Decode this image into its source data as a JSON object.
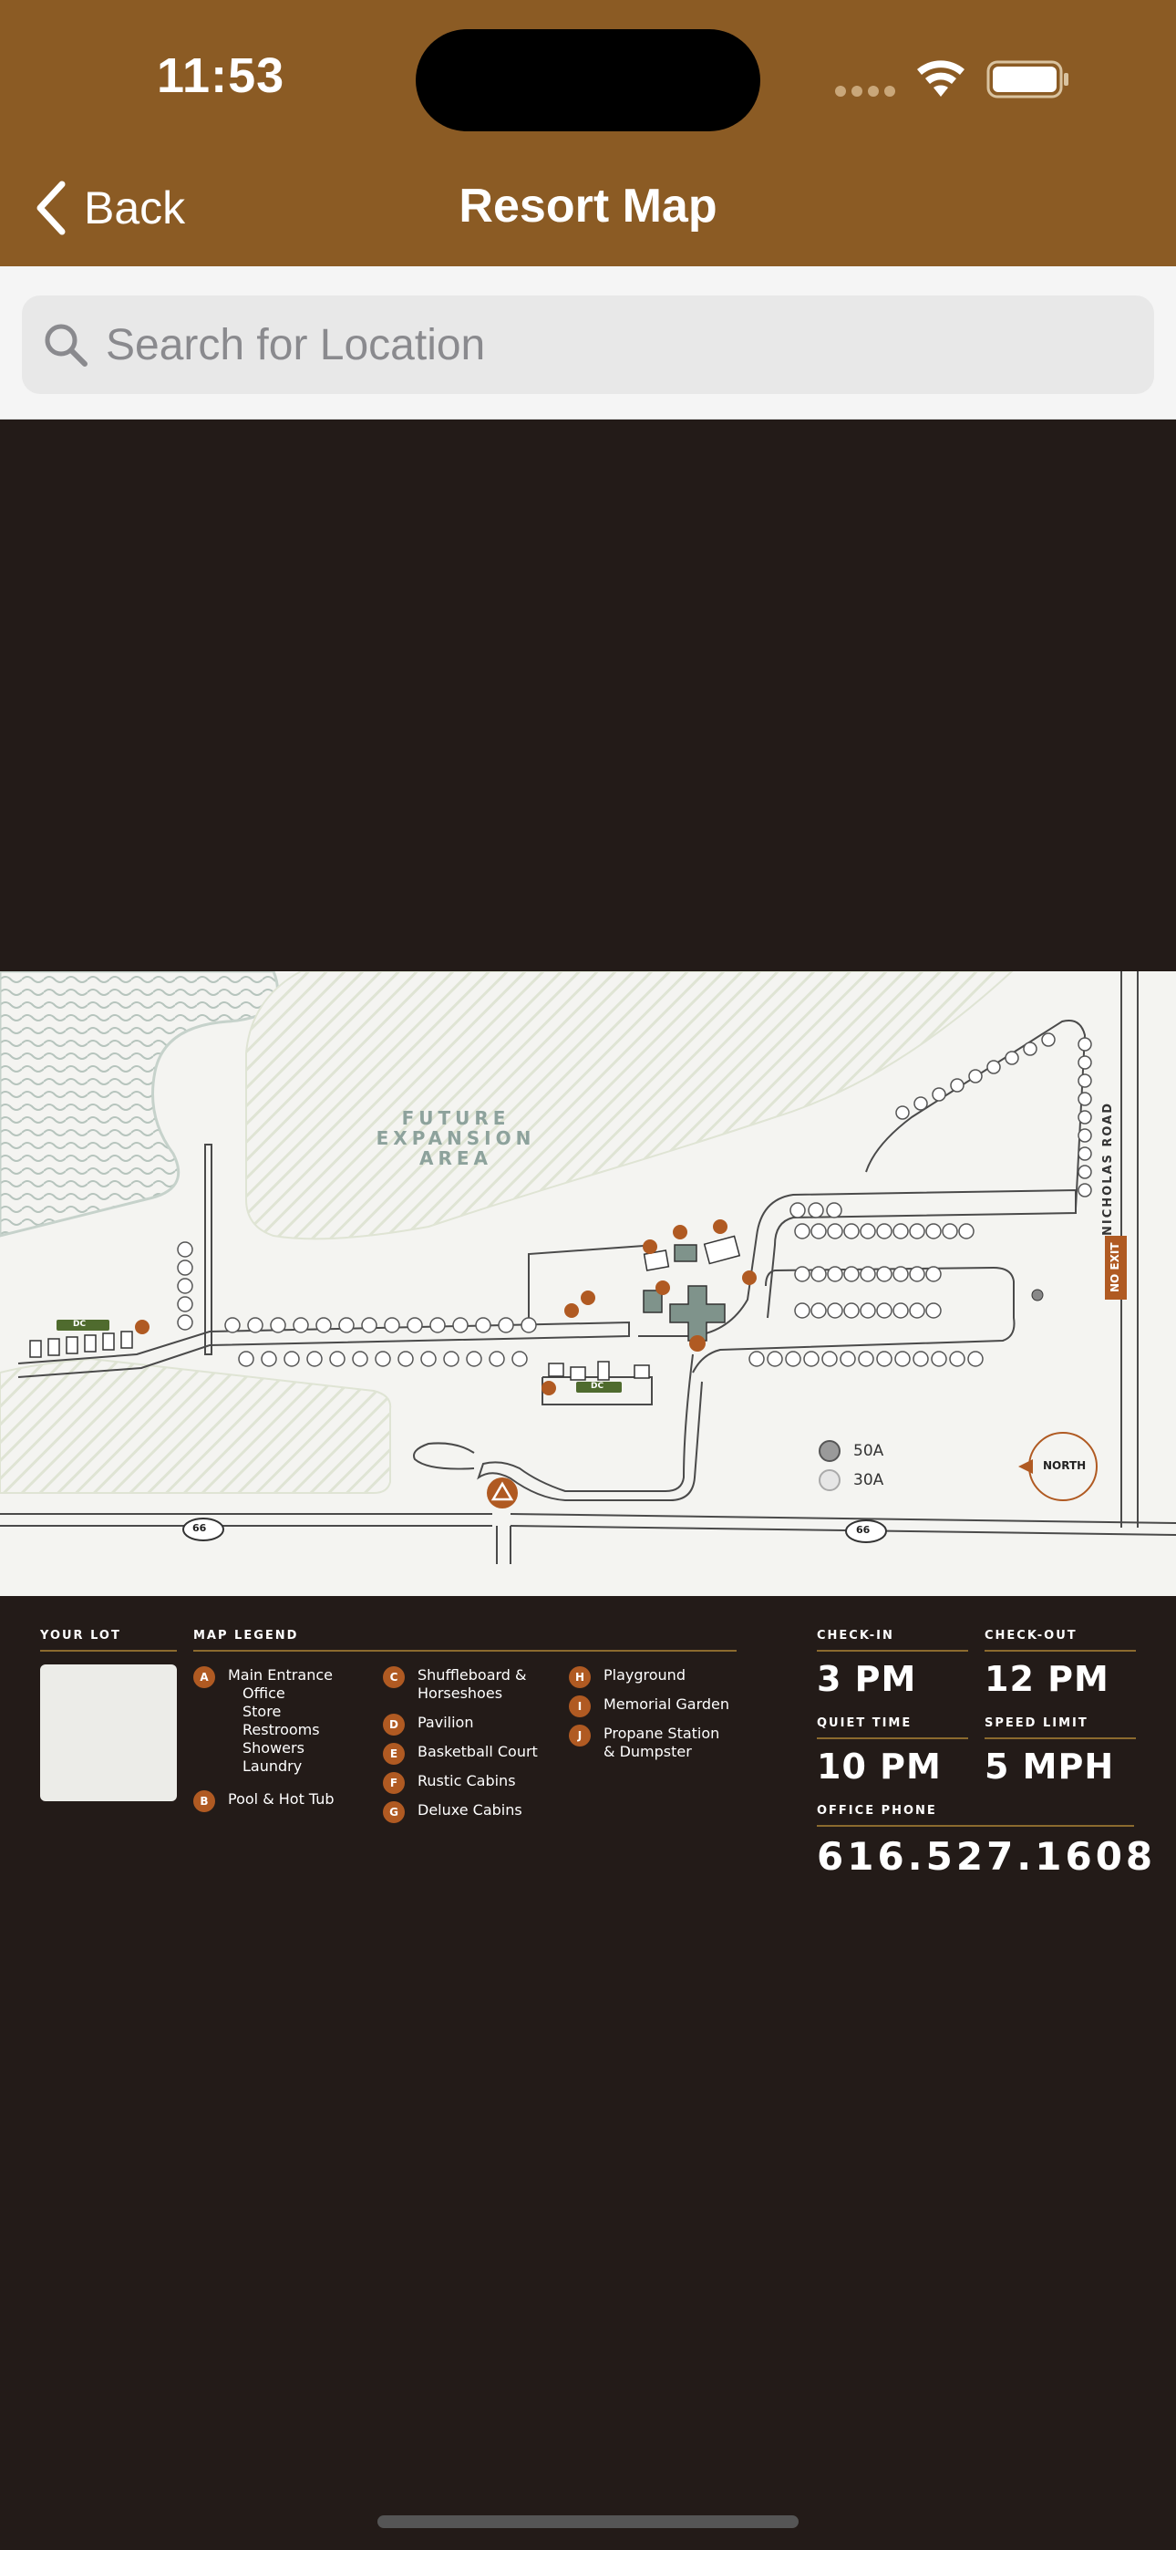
{
  "status_bar": {
    "time": "11:53"
  },
  "nav": {
    "back_label": "Back",
    "title": "Resort Map"
  },
  "search": {
    "placeholder": "Search for Location"
  },
  "map": {
    "future_area": "FUTURE EXPANSION AREA",
    "road_name": "NICHOLAS ROAD",
    "no_exit": "NO EXIT",
    "route_number": "66",
    "north": "NORTH",
    "amp_50": "50A",
    "amp_30": "30A",
    "dc": "DC",
    "accent_color": "#b05a22",
    "building_color": "#7f938b"
  },
  "info": {
    "your_lot_label": "YOUR LOT",
    "legend_title": "MAP LEGEND",
    "legend": {
      "a": {
        "letter": "A",
        "items": [
          "Main Entrance",
          "Office",
          "Store",
          "Restrooms",
          "Showers",
          "Laundry"
        ]
      },
      "b": {
        "letter": "B",
        "label": "Pool & Hot Tub"
      },
      "c": {
        "letter": "C",
        "label1": "Shuffleboard &",
        "label2": "Horseshoes"
      },
      "d": {
        "letter": "D",
        "label": "Pavilion"
      },
      "e": {
        "letter": "E",
        "label": "Basketball Court"
      },
      "f": {
        "letter": "F",
        "label": "Rustic Cabins"
      },
      "g": {
        "letter": "G",
        "label": "Deluxe Cabins"
      },
      "h": {
        "letter": "H",
        "label": "Playground"
      },
      "i": {
        "letter": "I",
        "label": "Memorial Garden"
      },
      "j": {
        "letter": "J",
        "label1": "Propane Station",
        "label2": "& Dumpster"
      }
    },
    "checkin_label": "CHECK-IN",
    "checkin": "3 PM",
    "checkout_label": "CHECK-OUT",
    "checkout": "12 PM",
    "quiet_label": "QUIET TIME",
    "quiet": "10 PM",
    "speed_label": "SPEED LIMIT",
    "speed": "5 MPH",
    "phone_label": "OFFICE PHONE",
    "phone": "616.527.1608"
  }
}
